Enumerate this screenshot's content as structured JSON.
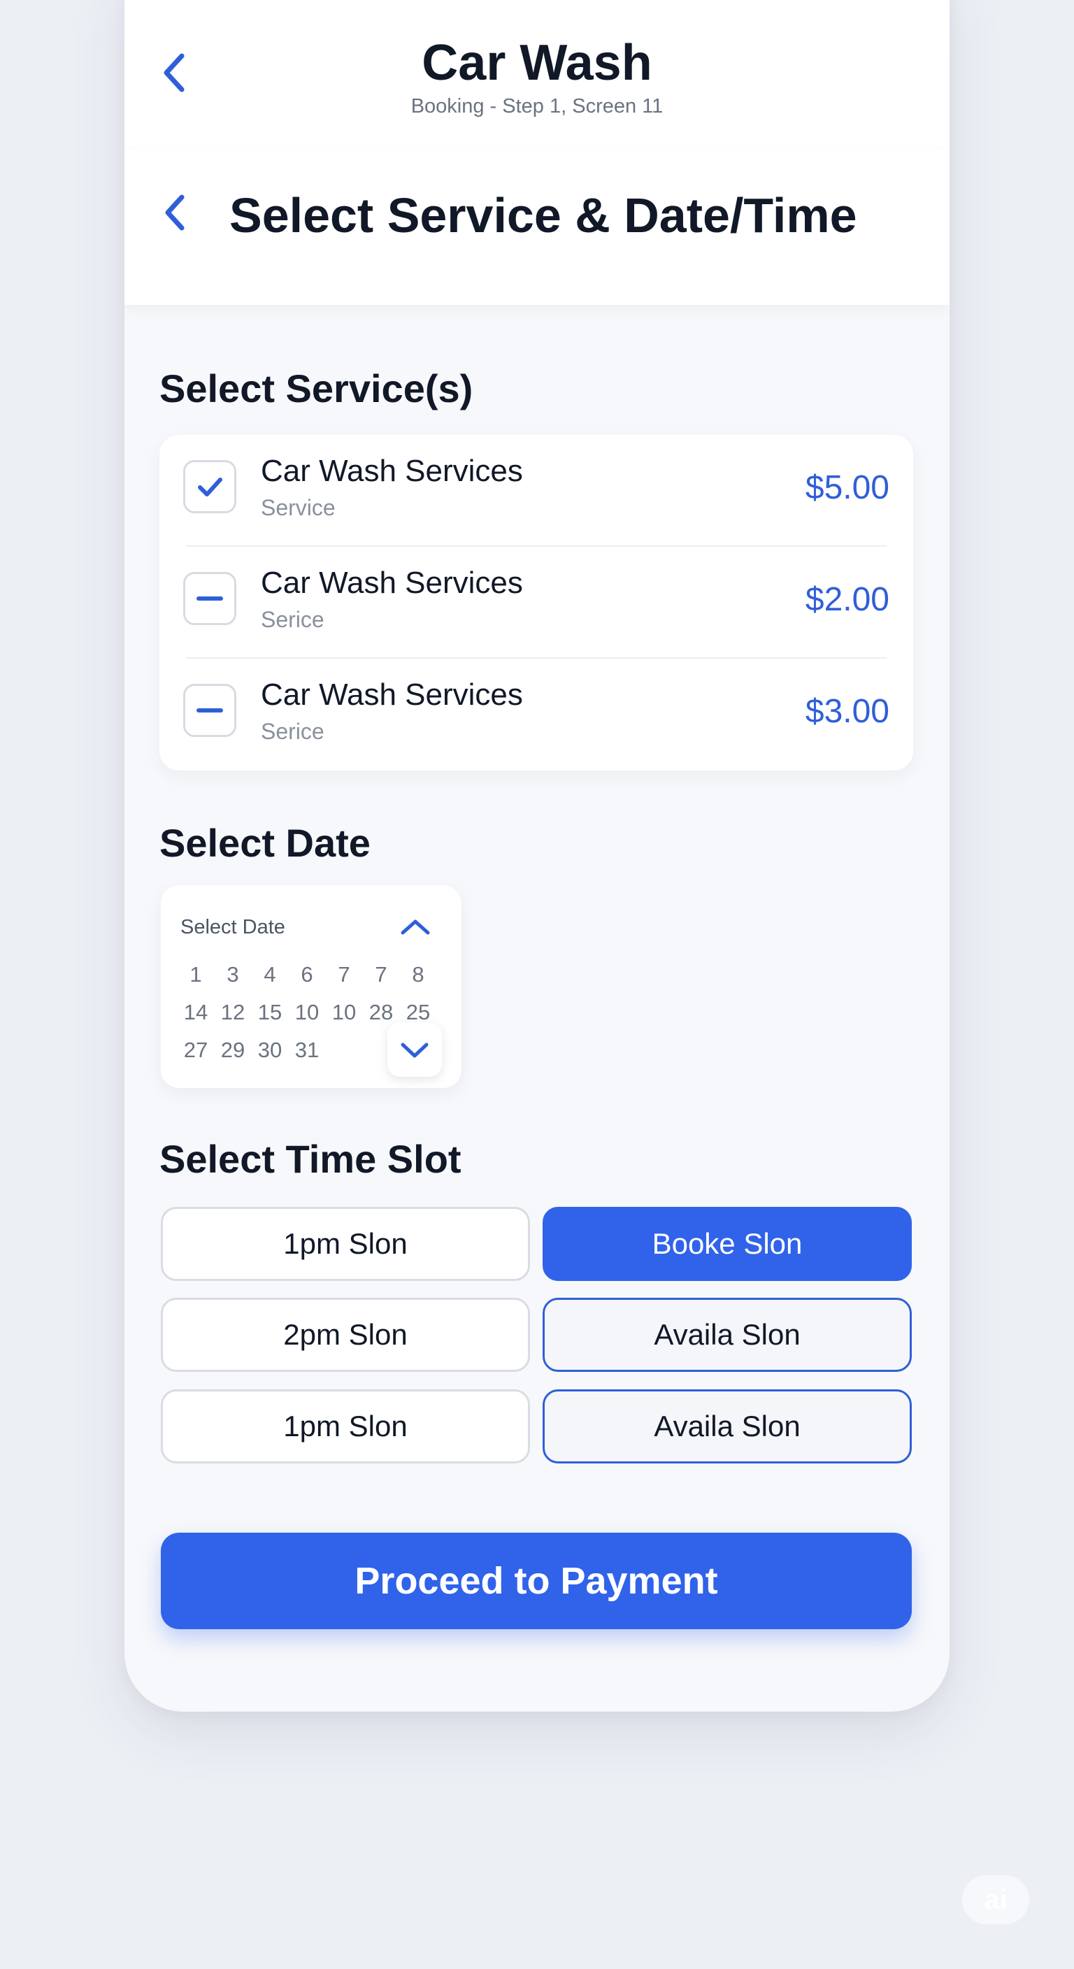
{
  "app": {
    "title": "Car Wash",
    "subtitle": "Booking - Step 1, Screen 11"
  },
  "page": {
    "title": "Select Service & Date/Time"
  },
  "services": {
    "heading": "Select Service(s)",
    "items": [
      {
        "name": "Car Wash Services",
        "type": "Service",
        "price": "$5.00",
        "state": "checked"
      },
      {
        "name": "Car Wash Services",
        "type": "Serice",
        "price": "$2.00",
        "state": "indeterminate"
      },
      {
        "name": "Car Wash Services",
        "type": "Serice",
        "price": "$3.00",
        "state": "indeterminate"
      }
    ]
  },
  "date": {
    "heading": "Select Date",
    "picker_label": "Select Date",
    "rows": [
      [
        "1",
        "3",
        "4",
        "6",
        "7",
        "7",
        "8"
      ],
      [
        "14",
        "12",
        "15",
        "10",
        "10",
        "28",
        "25"
      ],
      [
        "27",
        "29",
        "30",
        "31"
      ]
    ]
  },
  "time": {
    "heading": "Select Time Slot",
    "slots": [
      {
        "label": "1pm Slon",
        "state": "default"
      },
      {
        "label": "Booke Slon",
        "state": "booked"
      },
      {
        "label": "2pm Slon",
        "state": "default"
      },
      {
        "label": "Availa Slon",
        "state": "available"
      },
      {
        "label": "1pm Slon",
        "state": "default"
      },
      {
        "label": "Availa Slon",
        "state": "available"
      }
    ]
  },
  "cta": {
    "label": "Proceed to Payment"
  },
  "badge": {
    "label": "ai"
  },
  "colors": {
    "accent": "#3063ea",
    "price": "#2f5fd8",
    "text": "#111827",
    "muted": "#8a909c"
  },
  "icons": {
    "back": "chevron-left-icon",
    "checked": "check-icon",
    "indeterminate": "minus-icon",
    "up": "chevron-up-icon",
    "down": "chevron-down-icon"
  }
}
